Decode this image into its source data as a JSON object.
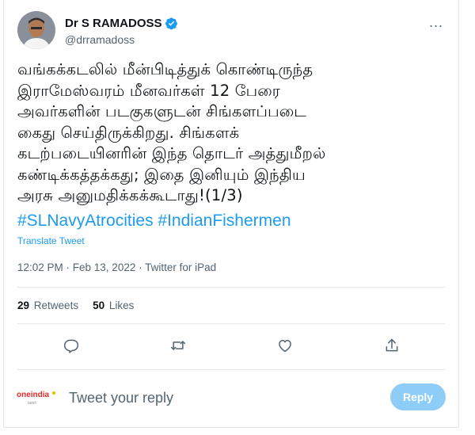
{
  "author": {
    "display_name": "Dr S RAMADOSS",
    "handle": "@drramadoss",
    "verified": true
  },
  "more_icon": "...",
  "tweet": {
    "text": "வங்கக்கடலில் மீன்பிடித்துக் கொண்டிருந்த\nஇராமேஸ்வரம் மீனவர்கள் 12 பேரை\nஅவர்களின் படகுகளுடன் சிங்களப்படை\nகைது செய்திருக்கிறது. சிங்களக்\nகடற்படையினரின் இந்த தொடர் அத்துமீறல்\nகண்டிக்கத்தக்கது; இதை இனியும் இந்திய\nஅரசு அனுமதிக்கக்கூடாது!(1/3)",
    "hashtags": [
      "#SLNavyAtrocities",
      "#IndianFishermen"
    ],
    "translate_label": "Translate Tweet",
    "timestamp": "12:02 PM · Feb 13, 2022 · Twitter for iPad"
  },
  "stats": {
    "retweets_count": "29",
    "retweets_label": "Retweets",
    "likes_count": "50",
    "likes_label": "Likes"
  },
  "actions": [
    "reply-icon",
    "retweet-icon",
    "like-icon",
    "share-icon"
  ],
  "reply_bar": {
    "logo_text": "oneindia",
    "logo_subtext": "tamil",
    "placeholder": "Tweet your reply",
    "button_label": "Reply"
  },
  "colors": {
    "accent": "#1d9bf0",
    "reply_button_disabled": "#8ecdf8",
    "logo_red": "#e52a2a"
  }
}
